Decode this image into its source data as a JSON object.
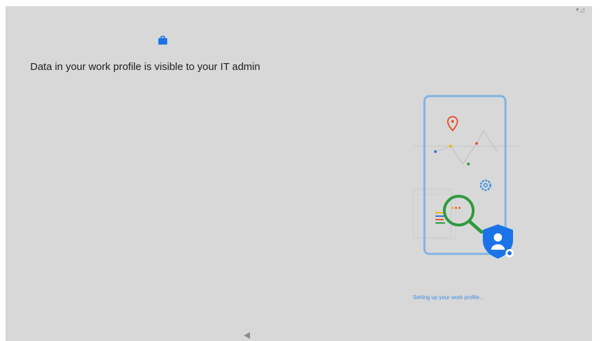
{
  "header": {
    "title": "Data in your work profile is visible to your IT admin",
    "icon": "briefcase-icon",
    "icon_color": "#1a73e8"
  },
  "status_bar": {
    "icons": [
      "wifi-icon",
      "signal-icon"
    ]
  },
  "progress": {
    "text": "Setting up your work profile..."
  },
  "navigation": {
    "back_icon": "back-triangle-icon"
  },
  "colors": {
    "background": "#d8d8d8",
    "accent": "#3a8de0",
    "phone_outline": "#7fb3e3",
    "magnifier": "#2e9a3e",
    "location_pin": "#e8532f"
  }
}
